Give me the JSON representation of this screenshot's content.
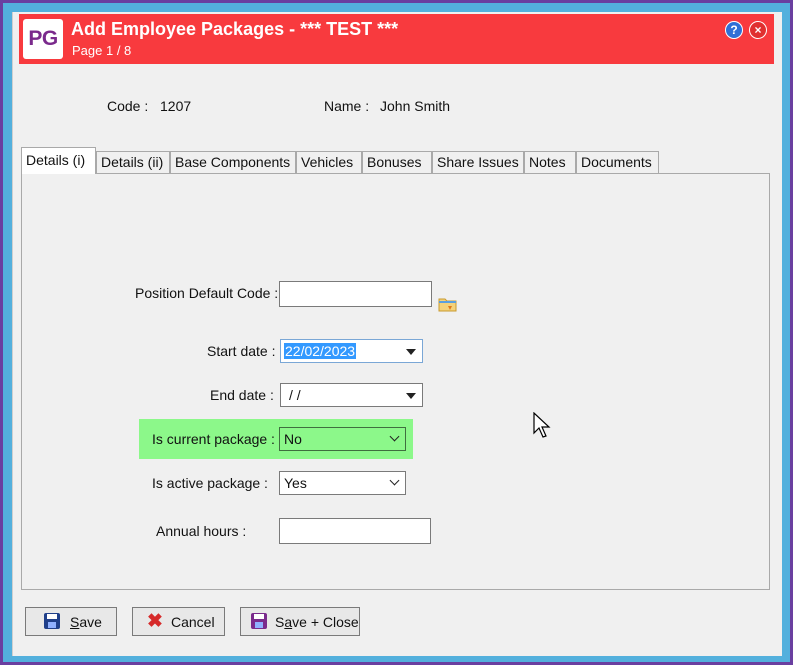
{
  "window": {
    "logo": "PG",
    "title": "Add Employee Packages - *** TEST ***",
    "subtitle": "Page 1 / 8",
    "help": "?",
    "close": "×"
  },
  "header": {
    "code_label": "Code :",
    "code_value": "1207",
    "name_label": "Name :",
    "name_value": "John Smith"
  },
  "tabs": [
    {
      "label": "Details (i)",
      "active": true
    },
    {
      "label": "Details (ii)"
    },
    {
      "label": "Base Components"
    },
    {
      "label": "Vehicles"
    },
    {
      "label": "Bonuses"
    },
    {
      "label": "Share Issues"
    },
    {
      "label": "Notes"
    },
    {
      "label": "Documents"
    }
  ],
  "form": {
    "position_default_code_label": "Position Default Code :",
    "position_default_code_value": "",
    "start_date_label": "Start date :",
    "start_date_value": "22/02/2023",
    "end_date_label": "End date :",
    "end_date_value": " /  /",
    "is_current_label": "Is current package :",
    "is_current_value": "No",
    "is_active_label": "Is active package :",
    "is_active_value": "Yes",
    "annual_hours_label": "Annual hours :",
    "annual_hours_value": ""
  },
  "buttons": {
    "save_first": "S",
    "save_rest": "ave",
    "cancel": "Cancel",
    "save_close_a": "S",
    "save_close_u": "a",
    "save_close_b": "ve + Close"
  },
  "colors": {
    "titlebar": "#f83a3e",
    "frame": "#53b0dd",
    "highlight": "#8cf88a"
  }
}
